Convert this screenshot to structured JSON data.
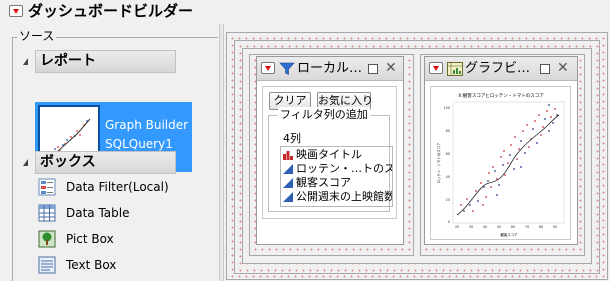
{
  "window": {
    "title": "ダッシュボードビルダー"
  },
  "sources": {
    "group_label": "ソース",
    "reports_header": "レポート",
    "report_items": [
      {
        "line1": "Graph Builder",
        "line2": "SQLQuery1"
      }
    ],
    "boxes_header": "ボックス",
    "box_items": [
      {
        "label": "Data Filter(Local)",
        "icon": "data-filter-icon"
      },
      {
        "label": "Data Table",
        "icon": "data-table-icon"
      },
      {
        "label": "Pict Box",
        "icon": "pict-box-icon"
      },
      {
        "label": "Text Box",
        "icon": "text-box-icon"
      }
    ]
  },
  "canvas": {
    "filter_panel": {
      "title": "ローカル…",
      "clear_label": "クリア",
      "favorites_label": "お気に入り",
      "add_filter_legend": "フィルタ列の追加",
      "columns_count": "4列",
      "columns": [
        {
          "label": "映画タイトル",
          "type": "nominal"
        },
        {
          "label": "ロッテン・…トのスコア",
          "type": "continuous"
        },
        {
          "label": "観客スコア",
          "type": "continuous"
        },
        {
          "label": "公開週末の上映館数",
          "type": "continuous"
        }
      ]
    },
    "graph_panel": {
      "title": "グラフビ…",
      "plot_title": "X:観客スコアとロッテン・トマトのスコア",
      "x_label": "観客スコア",
      "y_label": "ロッテン・トマトのスコア",
      "x_ticks": [
        "20",
        "30",
        "40",
        "50",
        "60",
        "70",
        "80",
        "90"
      ],
      "y_ticks": [
        "100",
        "80",
        "60",
        "40",
        "20",
        "0"
      ]
    }
  },
  "colors": {
    "selection": "#3399ff",
    "menu_triangle": "#dd1111",
    "filter_icon": "#2f6fd6"
  }
}
